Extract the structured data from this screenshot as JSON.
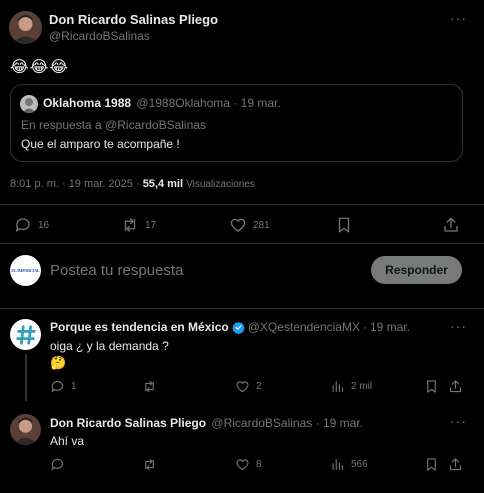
{
  "main_tweet": {
    "author_name": "Don Ricardo Salinas Pliego",
    "handle": "@RicardoBSalinas",
    "text": "😂😂😂",
    "quoted": {
      "author_name": "Oklahoma 1988",
      "handle": "@1988Oklahoma",
      "separator": "·",
      "date": "19 mar.",
      "reply_to": "En respuesta a @RicardoBSalinas",
      "text": "Que el amparo te acompañe !"
    },
    "time": "8:01 p. m. · 19 mar. 2025 ·",
    "views_count": "55,4 mil",
    "views_label": "Visualizaciones",
    "replies": "16",
    "retweets": "17",
    "likes": "281"
  },
  "reply_box": {
    "avatar_text": "EL IMPARCIAL",
    "placeholder": "Postea tu respuesta",
    "button_label": "Responder"
  },
  "replies": [
    {
      "author_name": "Porque es tendencia en México",
      "handle": "@XQestendenciaMX",
      "separator": "·",
      "date": "19 mar.",
      "text": "oiga ¿ y la demanda ?",
      "emoji": "🤔",
      "replies": "1",
      "retweets": "",
      "likes": "2",
      "views": "2 mil"
    },
    {
      "author_name": "Don Ricardo Salinas Pliego",
      "handle": "@RicardoBSalinas",
      "separator": "·",
      "date": "19 mar.",
      "text": "Ahí va",
      "replies": "",
      "retweets": "",
      "likes": "8",
      "views": "566"
    }
  ],
  "icons": {
    "more": "more-dots-icon",
    "reply": "comment-icon",
    "retweet": "retweet-icon",
    "like": "heart-icon",
    "views": "views-bar-icon",
    "bookmark": "bookmark-icon",
    "share": "share-icon",
    "verified": "verified-badge-icon",
    "hashtag": "hashtag-avatar-icon"
  },
  "colors": {
    "background": "#000000",
    "text": "#e7e9ea",
    "muted": "#71767b",
    "border": "#2f3336",
    "verified": "#1d9bf0",
    "button_bg": "#787a7a"
  }
}
